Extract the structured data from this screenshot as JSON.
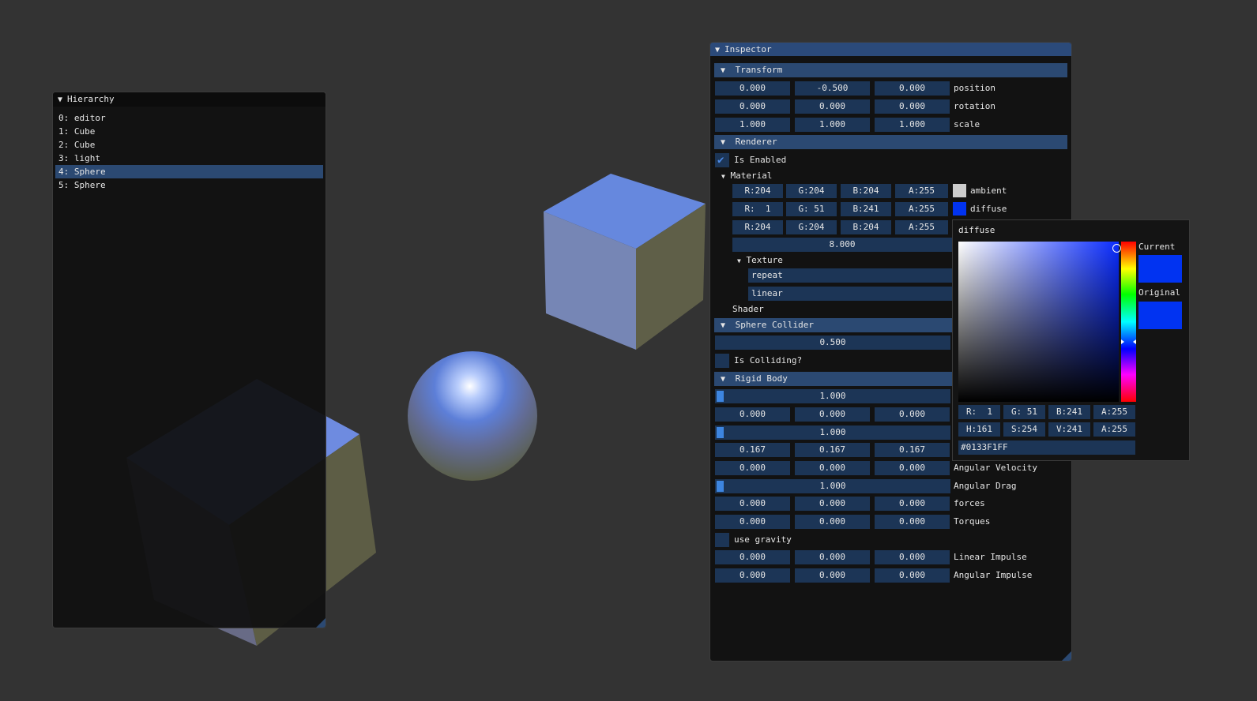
{
  "hierarchy": {
    "title": "Hierarchy",
    "items": [
      "0: editor",
      "1: Cube",
      "2: Cube",
      "3: light",
      "4: Sphere",
      "5: Sphere"
    ],
    "selected_index": 4
  },
  "inspector": {
    "title": "Inspector",
    "transform": {
      "header": "Transform",
      "position": {
        "label": "position",
        "values": [
          "0.000",
          "-0.500",
          "0.000"
        ]
      },
      "rotation": {
        "label": "rotation",
        "values": [
          "0.000",
          "0.000",
          "0.000"
        ]
      },
      "scale": {
        "label": "scale",
        "values": [
          "1.000",
          "1.000",
          "1.000"
        ]
      }
    },
    "renderer": {
      "header": "Renderer",
      "is_enabled_label": "Is Enabled",
      "is_enabled": true,
      "material_label": "Material",
      "ambient": {
        "label": "ambient",
        "values": [
          "R:204",
          "G:204",
          "B:204",
          "A:255"
        ],
        "color": "#cccccc"
      },
      "diffuse": {
        "label": "diffuse",
        "values": [
          "R:  1",
          "G: 51",
          "B:241",
          "A:255"
        ],
        "color": "#0133f1"
      },
      "specular": {
        "values": [
          "R:204",
          "G:204",
          "B:204",
          "A:255"
        ]
      },
      "shininess": "8.000",
      "texture_label": "Texture",
      "texture_wrap": "repeat",
      "texture_filter": "linear",
      "shader_label": "Shader"
    },
    "sphere_collider": {
      "header": "Sphere Collider",
      "radius": "0.500",
      "is_colliding_label": "Is Colliding?"
    },
    "rigid_body": {
      "header": "Rigid Body",
      "mass": {
        "value": "1.000",
        "fraction": 0.0
      },
      "row2": [
        "0.000",
        "0.000",
        "0.000"
      ],
      "drag": {
        "value": "1.000",
        "fraction": 0.0
      },
      "row4": [
        "0.167",
        "0.167",
        "0.167"
      ],
      "angular_velocity": {
        "label": "Angular Velocity",
        "values": [
          "0.000",
          "0.000",
          "0.000"
        ]
      },
      "angular_drag": {
        "label": "Angular Drag",
        "value": "1.000",
        "fraction": 0.0
      },
      "forces": {
        "label": "forces",
        "values": [
          "0.000",
          "0.000",
          "0.000"
        ]
      },
      "torques": {
        "label": "Torques",
        "values": [
          "0.000",
          "0.000",
          "0.000"
        ]
      },
      "use_gravity_label": "use gravity",
      "linear_impulse": {
        "label": "Linear Impulse",
        "values": [
          "0.000",
          "0.000",
          "0.000"
        ]
      },
      "angular_impulse": {
        "label": "Angular Impulse",
        "values": [
          "0.000",
          "0.000",
          "0.000"
        ]
      }
    }
  },
  "color_picker": {
    "title": "diffuse",
    "current_label": "Current",
    "original_label": "Original",
    "current_color": "#0133f1",
    "original_color": "#0133f1",
    "rgba": [
      "R:  1",
      "G: 51",
      "B:241",
      "A:255"
    ],
    "hsva": [
      "H:161",
      "S:254",
      "V:241",
      "A:255"
    ],
    "hex": "#0133F1FF"
  },
  "colors": {
    "background": "#333333",
    "accent": "#2b4972",
    "field": "#1c3556"
  }
}
